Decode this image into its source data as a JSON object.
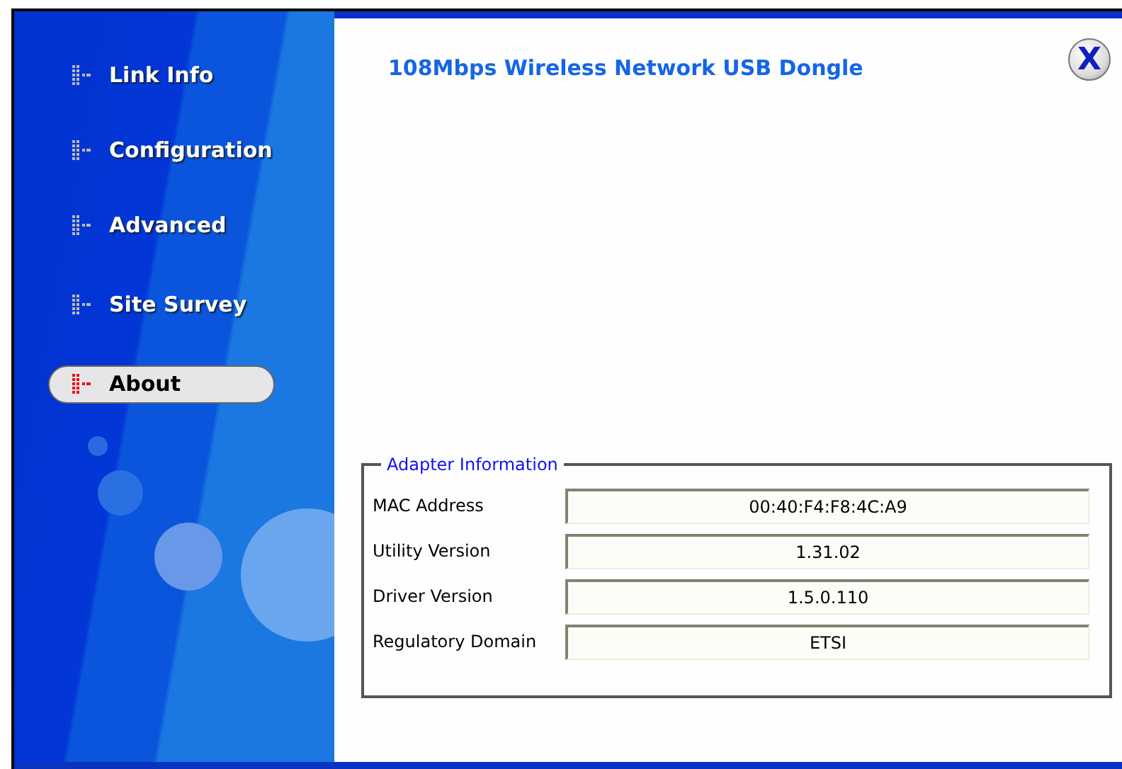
{
  "sidebar": {
    "items": [
      {
        "label": "Link Info",
        "selected": false
      },
      {
        "label": "Configuration",
        "selected": false
      },
      {
        "label": "Advanced",
        "selected": false
      },
      {
        "label": "Site Survey",
        "selected": false
      },
      {
        "label": "About",
        "selected": true
      }
    ]
  },
  "header": {
    "title": "108Mbps Wireless Network USB Dongle",
    "close": "X"
  },
  "adapter_information": {
    "title": "Adapter Information",
    "rows": [
      {
        "label": "MAC Address",
        "value": "00:40:F4:F8:4C:A9"
      },
      {
        "label": "Utility Version",
        "value": "1.31.02"
      },
      {
        "label": "Driver Version",
        "value": "1.5.0.110"
      },
      {
        "label": "Regulatory Domain",
        "value": "ETSI"
      }
    ]
  }
}
